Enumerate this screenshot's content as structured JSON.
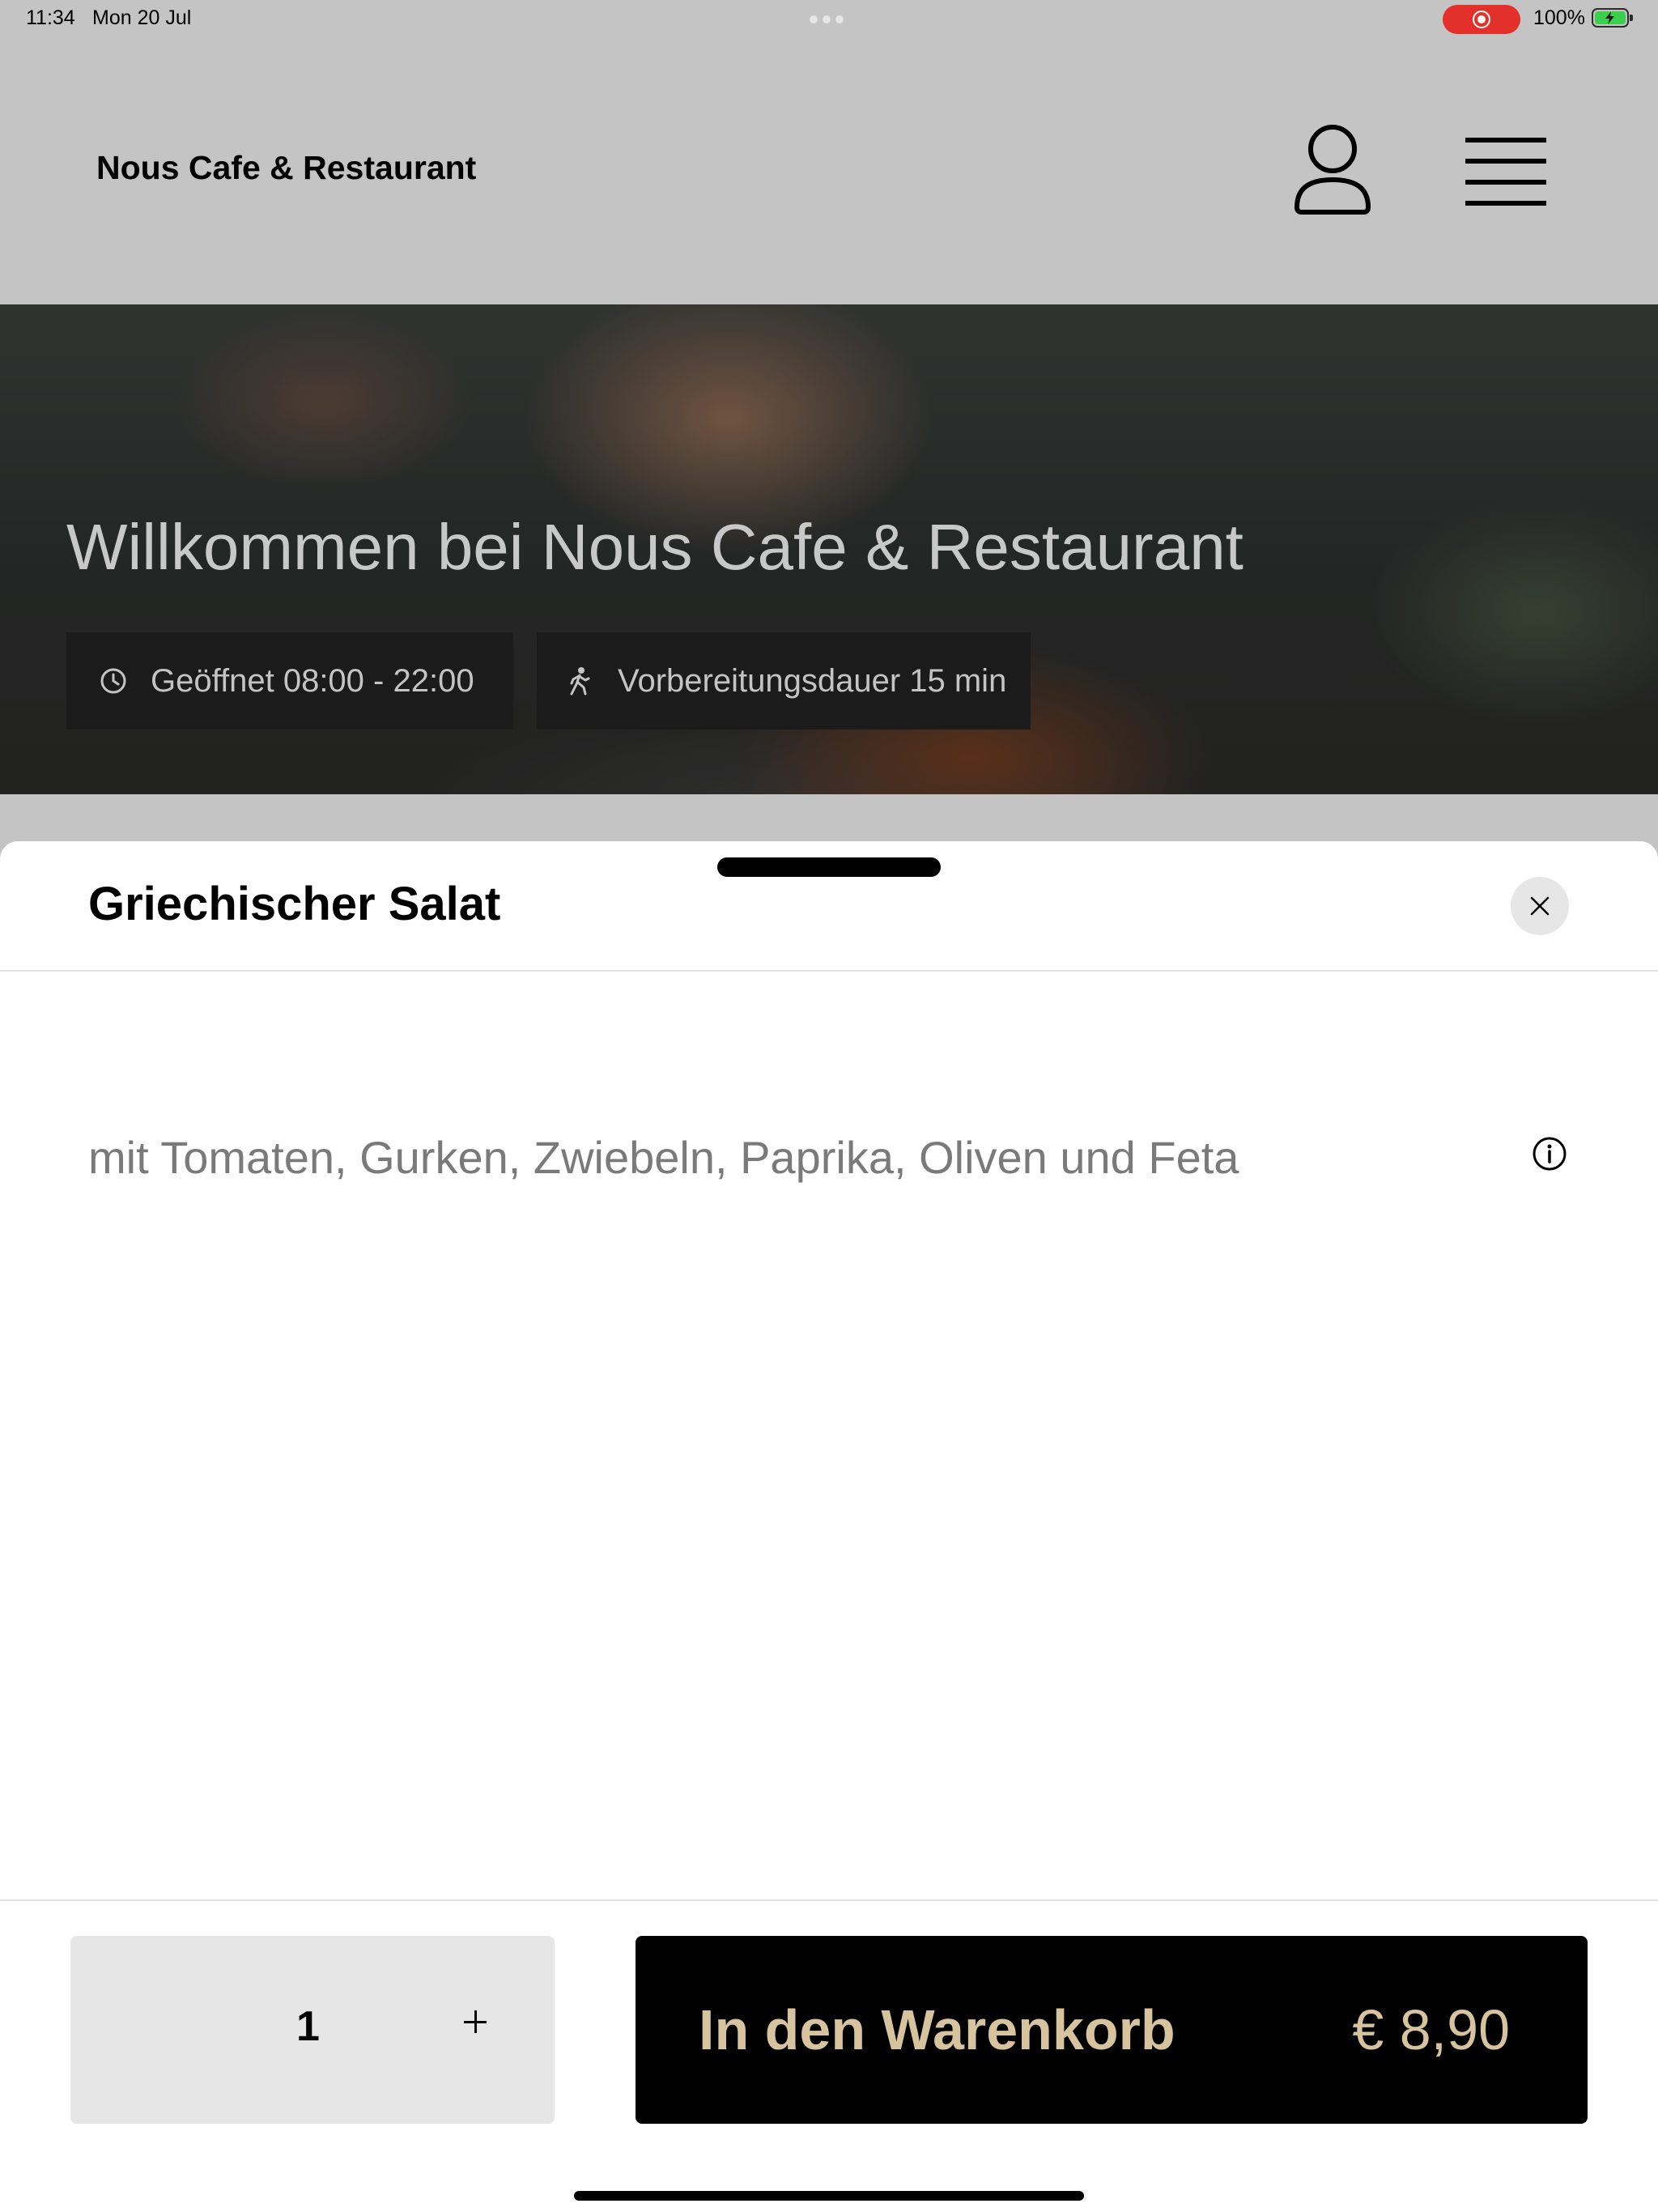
{
  "status_bar": {
    "time": "11:34",
    "date": "Mon 20 Jul",
    "battery": "100%"
  },
  "header": {
    "brand": "Nous Cafe & Restaurant",
    "user_icon": "user-icon",
    "menu_icon": "hamburger-menu-icon"
  },
  "hero": {
    "title": "Willkommen bei Nous Cafe & Restaurant",
    "opening_hours": "Geöffnet 08:00 - 22:00",
    "prep_time": "Vorbereitungsdauer 15 min",
    "opening_icon": "clock-icon",
    "prep_icon": "walking-icon"
  },
  "product_sheet": {
    "title": "Griechischer Salat",
    "description": "mit Tomaten, Gurken, Zwiebeln, Paprika, Oliven und Feta",
    "close_icon": "close-icon",
    "info_icon": "info-icon",
    "quantity": "1",
    "add_to_cart_label": "In den Warenkorb",
    "price": "€ 8,90"
  },
  "colors": {
    "header_bg": "#c4c4c4",
    "accent_gold": "#d7c39e",
    "button_black": "#000000",
    "recording_red": "#e4302b"
  }
}
